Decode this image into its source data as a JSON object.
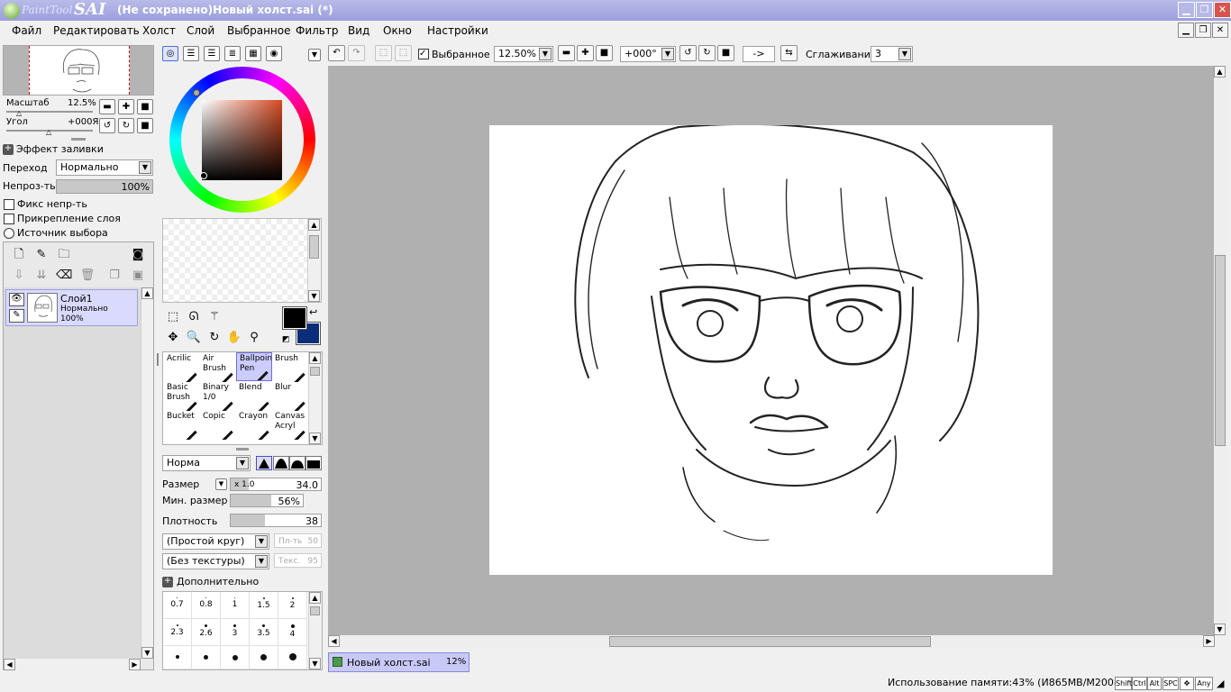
{
  "window": {
    "logo_small": "PaintTool",
    "logo_big": "SAI",
    "title": "(Не сохранено)Новый холст.sai (*)"
  },
  "menu": [
    "Файл",
    "Редактировать",
    "Холст",
    "Слой",
    "Выбранное",
    "Фильтр",
    "Вид",
    "Окно",
    "Настройки"
  ],
  "navigator": {
    "scale_label": "Масштаб",
    "scale_value": "12.5%",
    "angle_label": "Угол",
    "angle_value": "+000Я"
  },
  "fill_effect": {
    "title": "Эффект заливки",
    "blend_label": "Переход",
    "blend_value": "Нормально",
    "opacity_label": "Непроз-ть",
    "opacity_value": "100%",
    "opacity_fraction": 1.0
  },
  "layer_options": {
    "preserve_opacity": "Фикс непр-ть",
    "clipping": "Прикрепление слоя",
    "selection_source": "Источник выбора"
  },
  "layers": [
    {
      "name": "Слой1",
      "mode": "Нормально",
      "opacity": "100%"
    }
  ],
  "brushes": [
    [
      {
        "name": "Acrilic"
      },
      {
        "name": "Air Brush"
      },
      {
        "name": "Ballpoint Pen",
        "selected": true
      },
      {
        "name": "Brush"
      }
    ],
    [
      {
        "name": "Basic Brush"
      },
      {
        "name": "Binary 1/0"
      },
      {
        "name": "Blend"
      },
      {
        "name": "Blur"
      }
    ],
    [
      {
        "name": "Bucket"
      },
      {
        "name": "Copic"
      },
      {
        "name": "Crayon"
      },
      {
        "name": "Canvas Acryl"
      }
    ]
  ],
  "brush_settings": {
    "mode_value": "Норма",
    "size_label": "Размер",
    "size_multiplier": "x 1.0",
    "size_value": "34.0",
    "size_fraction": 0.2,
    "min_size_label": "Мин. размер",
    "min_size_value": "56%",
    "min_size_fraction": 0.56,
    "density_label": "Плотность",
    "density_value": "38",
    "density_fraction": 0.38,
    "shape_value": "(Простой круг)",
    "shape_density_label": "Пл-ть",
    "shape_density_value": "50",
    "texture_value": "(Без текстуры)",
    "texture_label": "Текс.",
    "texture_value_num": "95",
    "advanced_label": "Дополнительно"
  },
  "size_presets": [
    [
      "0.7",
      "0.8",
      "1",
      "1.5",
      "2"
    ],
    [
      "2.3",
      "2.6",
      "3",
      "3.5",
      "4"
    ]
  ],
  "toolbar": {
    "selection_label": "Выбранное",
    "zoom_value": "12.50%",
    "angle_value": "+000°",
    "flip_label": "->",
    "smoothing_label": "Сглаживание",
    "smoothing_value": "3"
  },
  "tab": {
    "name": "Новый холст.sai",
    "zoom": "12%"
  },
  "status": {
    "memory": "Использование памяти:43% (И865MB/M2008MB)",
    "keys": [
      "Shift",
      "Ctrl",
      "Alt",
      "SPC",
      "Any"
    ]
  },
  "colors": {
    "accent": "#9b9edc",
    "selection": "#dadaff",
    "foreground": "#000000",
    "background": "#0a2e7a"
  }
}
